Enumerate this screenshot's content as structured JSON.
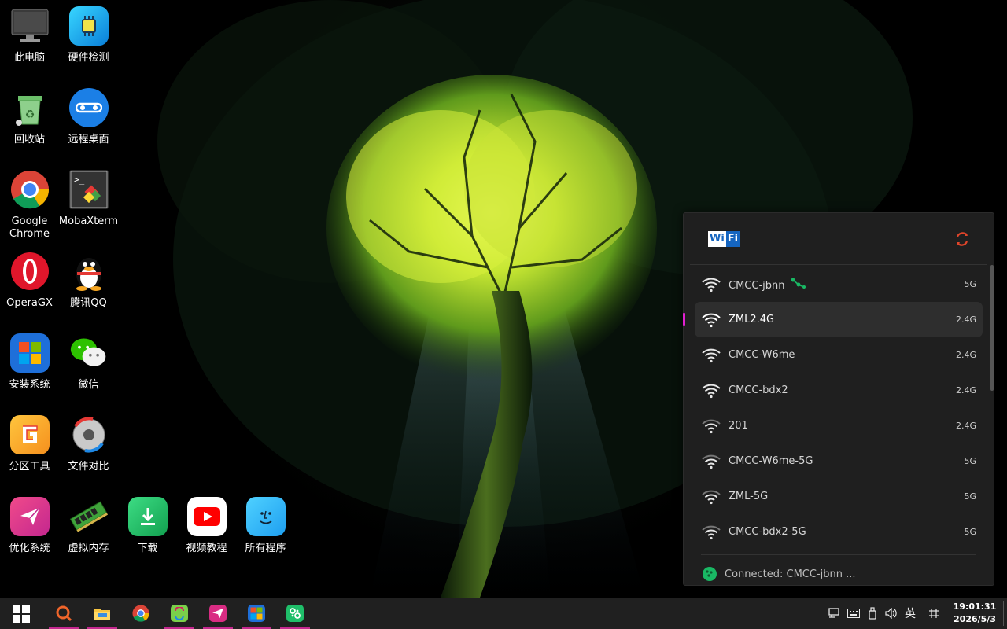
{
  "desktop": {
    "icons": [
      {
        "id": "this-pc",
        "label": "此电脑"
      },
      {
        "id": "hardware-check",
        "label": "硬件检测"
      },
      {
        "id": "recycle-bin",
        "label": "回收站"
      },
      {
        "id": "remote-desktop",
        "label": "远程桌面"
      },
      {
        "id": "chrome",
        "label": "Google Chrome"
      },
      {
        "id": "mobaxterm",
        "label": "MobaXterm"
      },
      {
        "id": "operagx",
        "label": "OperaGX"
      },
      {
        "id": "qq",
        "label": "腾讯QQ"
      },
      {
        "id": "install-system",
        "label": "安装系统"
      },
      {
        "id": "wechat",
        "label": "微信"
      },
      {
        "id": "partition-tool",
        "label": "分区工具"
      },
      {
        "id": "file-compare",
        "label": "文件对比"
      },
      {
        "id": "optimize-system",
        "label": "优化系统"
      },
      {
        "id": "virtual-memory",
        "label": "虚拟内存"
      },
      {
        "id": "download",
        "label": "下载"
      },
      {
        "id": "video-tutorial",
        "label": "视频教程"
      },
      {
        "id": "all-programs",
        "label": "所有程序"
      }
    ]
  },
  "wifi_panel": {
    "logo_wi": "Wi",
    "logo_fi": "Fi",
    "refresh_icon": "refresh-icon",
    "networks": [
      {
        "ssid": "CMCC-jbnn",
        "band": "5G",
        "connected": true,
        "active": false,
        "signal": 4
      },
      {
        "ssid": "ZML2.4G",
        "band": "2.4G",
        "connected": false,
        "active": true,
        "signal": 4
      },
      {
        "ssid": "CMCC-W6me",
        "band": "2.4G",
        "connected": false,
        "active": false,
        "signal": 4
      },
      {
        "ssid": "CMCC-bdx2",
        "band": "2.4G",
        "connected": false,
        "active": false,
        "signal": 4
      },
      {
        "ssid": "201",
        "band": "2.4G",
        "connected": false,
        "active": false,
        "signal": 3
      },
      {
        "ssid": "CMCC-W6me-5G",
        "band": "5G",
        "connected": false,
        "active": false,
        "signal": 3
      },
      {
        "ssid": "ZML-5G",
        "band": "5G",
        "connected": false,
        "active": false,
        "signal": 3
      },
      {
        "ssid": "CMCC-bdx2-5G",
        "band": "5G",
        "connected": false,
        "active": false,
        "signal": 3
      }
    ],
    "status": "Connected: CMCC-jbnn ..."
  },
  "taskbar": {
    "apps": [
      "start-icon",
      "search-tool-icon",
      "file-explorer-icon",
      "chrome-icon",
      "app-switch-icon",
      "telegram-icon",
      "installer-icon",
      "settings-icon"
    ],
    "tray": {
      "ime_label": "英",
      "time": "19:01:31",
      "date": "2026/5/3"
    }
  },
  "colors": {
    "accent_pink": "#c4278f",
    "active_bar": "#e020d0",
    "connected_green": "#19b864",
    "taskbar_bg": "#202020",
    "panel_bg": "#1f1f1f"
  }
}
